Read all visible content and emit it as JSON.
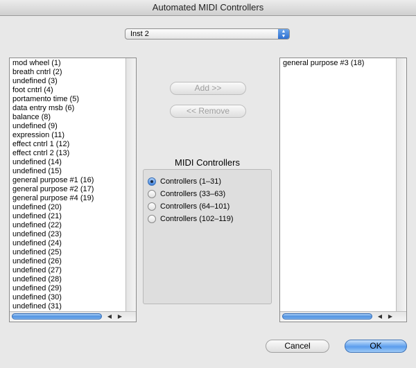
{
  "window": {
    "title": "Automated MIDI Controllers"
  },
  "instrument_select": {
    "value": "Inst 2"
  },
  "available_list": {
    "items": [
      "mod wheel (1)",
      "breath cntrl (2)",
      "undefined (3)",
      "foot cntrl (4)",
      "portamento time (5)",
      "data entry msb (6)",
      "balance (8)",
      "undefined (9)",
      "expression (11)",
      "effect cntrl 1 (12)",
      "effect cntrl 2 (13)",
      "undefined (14)",
      "undefined (15)",
      "general purpose #1 (16)",
      "general purpose #2 (17)",
      "general purpose #4 (19)",
      "undefined (20)",
      "undefined (21)",
      "undefined (22)",
      "undefined (23)",
      "undefined (24)",
      "undefined (25)",
      "undefined (26)",
      "undefined (27)",
      "undefined (28)",
      "undefined (29)",
      "undefined (30)",
      "undefined (31)"
    ]
  },
  "selected_list": {
    "items": [
      "general purpose #3 (18)"
    ]
  },
  "buttons": {
    "add": "Add >>",
    "remove": "<< Remove",
    "cancel": "Cancel",
    "ok": "OK"
  },
  "midi_group": {
    "title": "MIDI Controllers",
    "options": [
      {
        "label": "Controllers (1–31)",
        "selected": true
      },
      {
        "label": "Controllers (33–63)",
        "selected": false
      },
      {
        "label": "Controllers (64–101)",
        "selected": false
      },
      {
        "label": "Controllers (102–119)",
        "selected": false
      }
    ]
  },
  "icons": {
    "popup_arrows": "updown-chevron-icon",
    "scroll_left": "triangle-left-icon",
    "scroll_right": "triangle-right-icon"
  }
}
